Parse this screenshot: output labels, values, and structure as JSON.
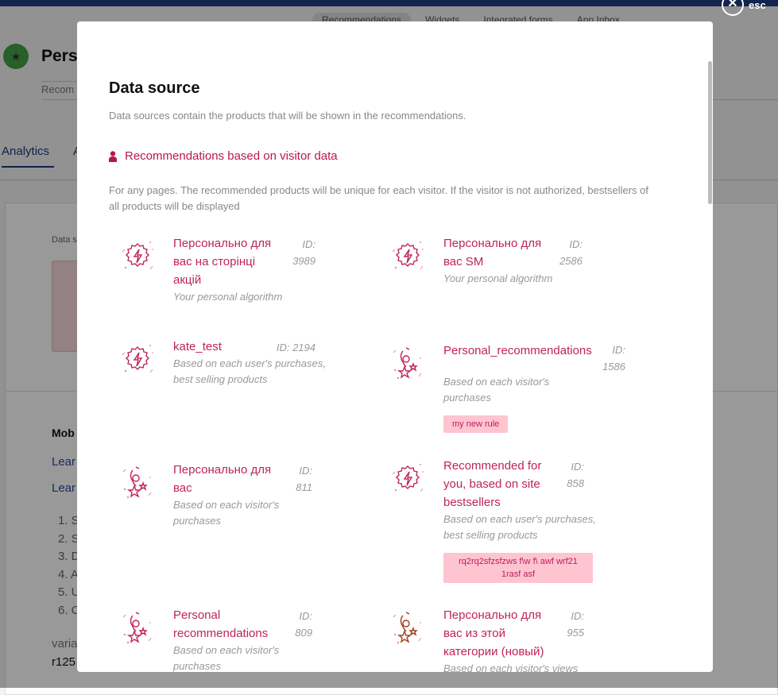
{
  "background": {
    "top_tabs": [
      "Recommendations",
      "Widgets",
      "Integrated forms",
      "App Inbox"
    ],
    "page_title": "Perso",
    "page_subtitle": "Recom",
    "tabs": [
      "Analytics",
      "A"
    ],
    "data_source_label": "Data s",
    "mobile_heading": "Mob",
    "learn_links": [
      "Lear",
      "Lear"
    ],
    "steps": [
      "1. S",
      "2. S",
      "3. D",
      "4. A",
      "5. U",
      "6. C"
    ],
    "variable_label": "varia",
    "variable_value": "r125"
  },
  "close": {
    "label": "esc"
  },
  "modal": {
    "title": "Data source",
    "description": "Data sources contain the products that will be shown in the recommendations.",
    "section": {
      "title": "Recommendations based on visitor data",
      "description": "For any pages. The recommended products will be unique for each visitor. If the visitor is not authorized, bestsellers of all products will be displayed"
    },
    "accent_color": "#bf2456",
    "items": [
      {
        "icon": "lightning-gear-icon",
        "title": "Персонально для вас на сторінці акцій",
        "id": "ID: 3989",
        "subtitle": "Your personal algorithm"
      },
      {
        "icon": "lightning-gear-icon",
        "title": "Персонально для вас SM",
        "id": "ID: 2586",
        "subtitle": "Your personal algorithm"
      },
      {
        "icon": "lightning-gear-icon",
        "title": "kate_test",
        "id": "ID: 2194",
        "subtitle": "Based on each user's purchases, best selling products"
      },
      {
        "icon": "person-stars-icon",
        "title": "Personal_recommendations",
        "id": "ID: 1586",
        "subtitle": "Based on each visitor's purchases",
        "tag": "my new rule"
      },
      {
        "icon": "person-stars-icon",
        "title": "Персонально для вас",
        "id": "ID: 811",
        "subtitle": "Based on each visitor's purchases"
      },
      {
        "icon": "lightning-gear-icon",
        "title": "Recommended for you, based on site bestsellers",
        "id": "ID: 858",
        "subtitle": "Based on each user's purchases, best selling products",
        "tag": "rq2rq2sfzsfzws f\\w f\\ awf wrf21 1rasf asf"
      },
      {
        "icon": "person-stars-icon",
        "title": "Personal recommendations",
        "id": "ID: 809",
        "subtitle": "Based on each visitor's purchases"
      },
      {
        "icon": "person-stars-icon",
        "title": "Персонально для вас из этой категории (новый)",
        "id": "ID: 955",
        "subtitle": "Based on each visitor's views"
      }
    ]
  }
}
